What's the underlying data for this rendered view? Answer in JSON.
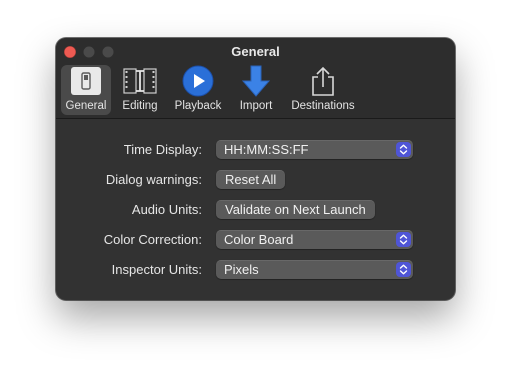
{
  "window": {
    "title": "General"
  },
  "toolbar": {
    "tabs": [
      {
        "label": "General",
        "icon": "switch-icon",
        "selected": true
      },
      {
        "label": "Editing",
        "icon": "filmstrip-icon",
        "selected": false
      },
      {
        "label": "Playback",
        "icon": "play-icon",
        "selected": false
      },
      {
        "label": "Import",
        "icon": "down-arrow-icon",
        "selected": false
      },
      {
        "label": "Destinations",
        "icon": "share-icon",
        "selected": false
      }
    ]
  },
  "settings": {
    "time_display": {
      "label": "Time Display:",
      "value": "HH:MM:SS:FF"
    },
    "dialog_warnings": {
      "label": "Dialog warnings:",
      "button": "Reset All"
    },
    "audio_units": {
      "label": "Audio Units:",
      "button": "Validate on Next Launch"
    },
    "color_correction": {
      "label": "Color Correction:",
      "value": "Color Board"
    },
    "inspector_units": {
      "label": "Inspector Units:",
      "value": "Pixels"
    }
  },
  "colors": {
    "accent": "#4f55d6",
    "play_blue": "#2a6fd8",
    "import_blue": "#3b82e6",
    "close_red": "#ee5a52"
  }
}
